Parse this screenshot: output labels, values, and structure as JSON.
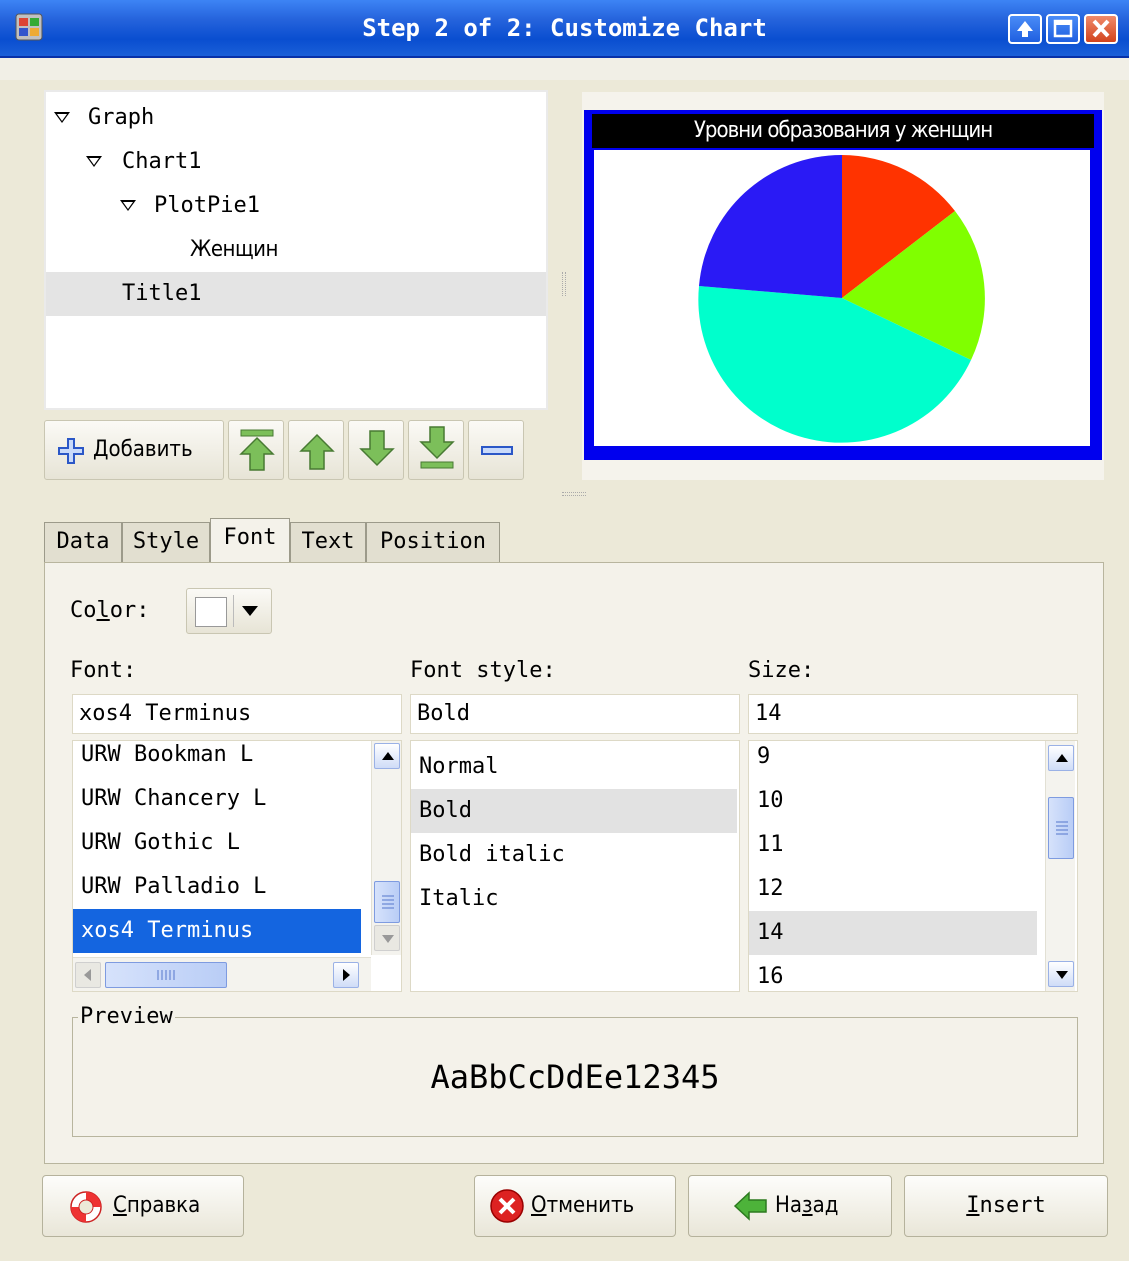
{
  "window": {
    "title": "Step 2 of 2: Customize Chart"
  },
  "tree": {
    "items": [
      {
        "label": "Graph",
        "expanded": true
      },
      {
        "label": "Chart1",
        "expanded": true
      },
      {
        "label": "PlotPie1",
        "expanded": true
      },
      {
        "label": "Женщин"
      },
      {
        "label": "Title1",
        "selected": true
      }
    ]
  },
  "toolbar": {
    "add_label": "Добавить",
    "add_mnemonic": "Д",
    "add_rest": "обавить",
    "icons": [
      "plus-icon",
      "move-top-icon",
      "move-up-icon",
      "move-down-icon",
      "move-bottom-icon",
      "minus-icon"
    ]
  },
  "chart_preview": {
    "title": "Уровни образования у женщин",
    "slice_colors": [
      "#ff3300",
      "#80ff00",
      "#00ffcc",
      "#2a1af5"
    ]
  },
  "tabs": [
    {
      "label": "Data"
    },
    {
      "label": "Style"
    },
    {
      "label": "Font",
      "active": true
    },
    {
      "label": "Text"
    },
    {
      "label": "Position"
    }
  ],
  "font_tab": {
    "color_label_pre": "Co",
    "color_label_mn": "l",
    "color_label_post": "or:",
    "color_value": "#ffffff",
    "font_label": "Font:",
    "font_style_label": "Font style:",
    "size_label": "Size:",
    "font_value": "xos4 Terminus",
    "font_style_value": "Bold",
    "size_value": "14",
    "font_list": [
      "URW Bookman L",
      "URW Chancery L",
      "URW Gothic L",
      "URW Palladio L",
      "xos4 Terminus"
    ],
    "font_selected": "xos4 Terminus",
    "style_list": [
      "Normal",
      "Bold",
      "Bold italic",
      "Italic"
    ],
    "style_selected": "Bold",
    "size_list": [
      "9",
      "10",
      "11",
      "12",
      "14",
      "16"
    ],
    "size_selected": "14",
    "preview_label": "Preview",
    "preview_text": "AaBbCcDdEe12345"
  },
  "buttons": {
    "help_pre": "",
    "help_mn": "С",
    "help_post": "правка",
    "cancel_pre": "",
    "cancel_mn": "О",
    "cancel_post": "тменить",
    "back_pre": "На",
    "back_mn": "з",
    "back_post": "ад",
    "insert_pre": "",
    "insert_mn": "I",
    "insert_post": "nsert"
  },
  "colors": {
    "titlebar": "#0a4ed0",
    "selection": "#1465e0",
    "chart_frame": "#0000ee"
  }
}
